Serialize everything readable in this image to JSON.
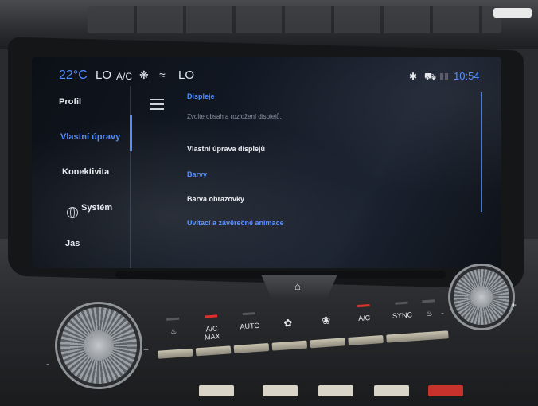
{
  "status_bar": {
    "temperature": "22°C",
    "fan_left": "LO",
    "ac": "A/C",
    "fan_right": "LO",
    "time": "10:54"
  },
  "sidebar": {
    "items": [
      {
        "label": "Profil"
      },
      {
        "label": "Vlastní úpravy"
      },
      {
        "label": "Konektivita"
      },
      {
        "label": "Systém"
      },
      {
        "label": "Jas"
      }
    ]
  },
  "content": {
    "section_title": "Displeje",
    "subtitle": "Zvolte obsah a rozložení displejů.",
    "option_displays": "Vlastní úprava displejů",
    "section_colors": "Barvy",
    "option_color": "Barva obrazovky",
    "section_animation": "Uvítací a závěrečné animace"
  },
  "climate": {
    "buttons": [
      {
        "label": ""
      },
      {
        "label": "A/C\nMAX"
      },
      {
        "label": "AUTO"
      },
      {
        "label": ""
      },
      {
        "label": ""
      },
      {
        "label": "A/C"
      },
      {
        "label": "SYNC"
      },
      {
        "label": ""
      }
    ],
    "minus": "-",
    "plus": "+"
  },
  "colors": {
    "accent": "#4f8cff",
    "led_active": "#e0302a"
  }
}
